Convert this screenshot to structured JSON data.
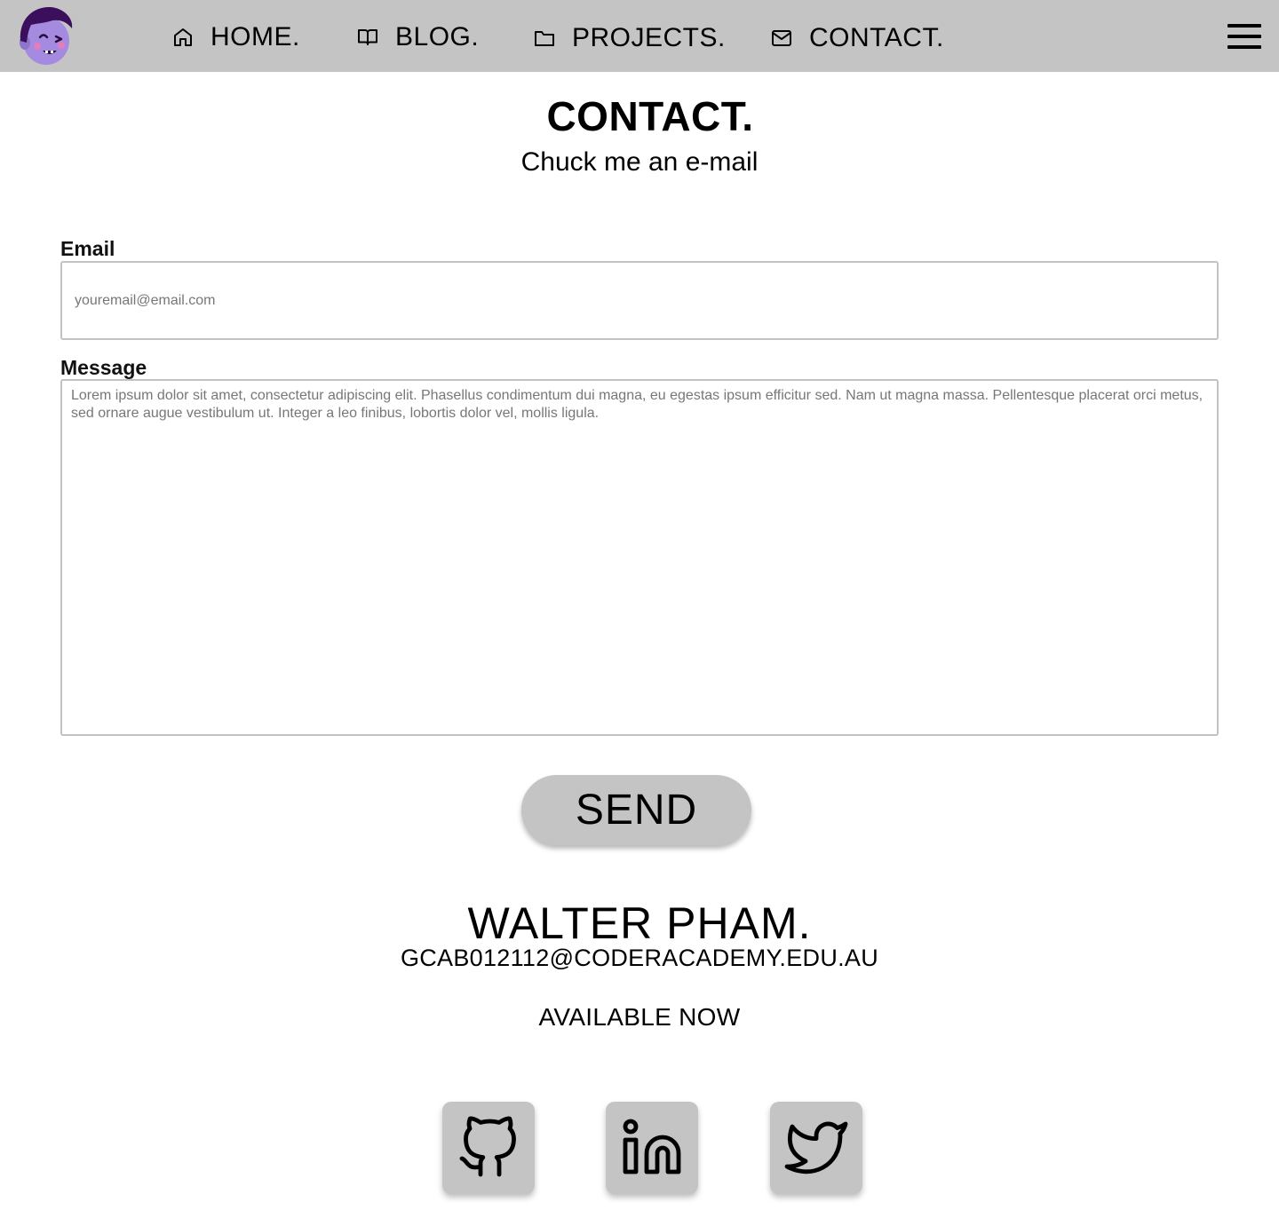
{
  "nav": {
    "items": [
      {
        "label": "HOME.",
        "icon": "home-icon"
      },
      {
        "label": "BLOG.",
        "icon": "book-icon"
      },
      {
        "label": "PROJECTS.",
        "icon": "folder-icon"
      },
      {
        "label": "CONTACT.",
        "icon": "mail-icon"
      }
    ],
    "menu_icon": "hamburger-menu-icon",
    "logo": "avatar-face"
  },
  "page": {
    "title": "CONTACT.",
    "subtitle": "Chuck me an e-mail"
  },
  "form": {
    "email_label": "Email",
    "email_placeholder": "youremail@email.com",
    "message_label": "Message",
    "message_placeholder": "Lorem ipsum dolor sit amet, consectetur adipiscing elit. Phasellus condimentum dui magna, eu egestas ipsum efficitur sed. Nam ut magna massa. Pellentesque placerat orci metus, sed ornare augue vestibulum ut. Integer a leo finibus, lobortis dolor vel, mollis ligula.",
    "send_label": "SEND"
  },
  "footer": {
    "name": "WALTER PHAM.",
    "email": "GCAB012112@CODERACADEMY.EDU.AU",
    "status": "AVAILABLE NOW",
    "socials": [
      "github-icon",
      "linkedin-icon",
      "twitter-icon"
    ]
  },
  "colors": {
    "navbar_bg": "#c4c4c4",
    "button_bg": "#c4c4c4",
    "avatar_skin": "#a48be0",
    "avatar_hair": "#3b0f5c"
  }
}
